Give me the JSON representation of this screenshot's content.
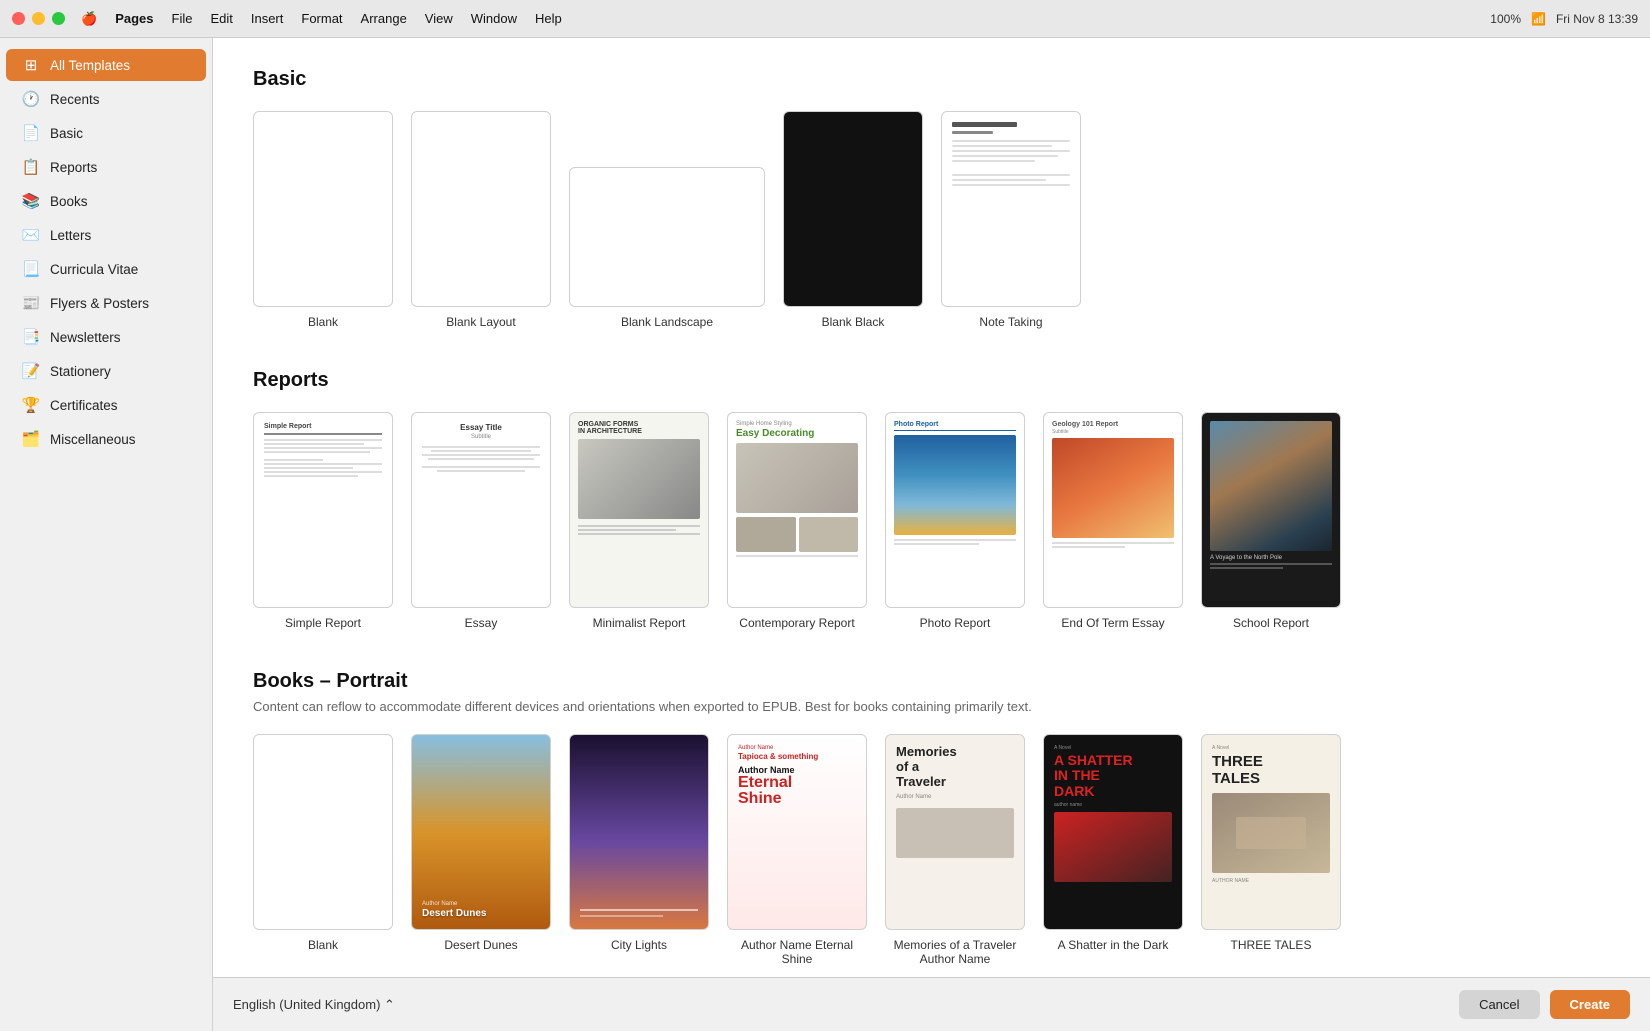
{
  "titlebar": {
    "app": "Pages",
    "menus": [
      "Apple",
      "Pages",
      "File",
      "Edit",
      "Insert",
      "Format",
      "Arrange",
      "View",
      "Window",
      "Help"
    ],
    "status": "100%",
    "time": "Fri Nov 8  13:39"
  },
  "sidebar": {
    "items": [
      {
        "id": "all-templates",
        "label": "All Templates",
        "icon": "⊞",
        "active": true
      },
      {
        "id": "recents",
        "label": "Recents",
        "icon": "🕐",
        "active": false
      },
      {
        "id": "basic",
        "label": "Basic",
        "icon": "📄",
        "active": false
      },
      {
        "id": "reports",
        "label": "Reports",
        "icon": "📋",
        "active": false
      },
      {
        "id": "books",
        "label": "Books",
        "icon": "📚",
        "active": false
      },
      {
        "id": "letters",
        "label": "Letters",
        "icon": "✉️",
        "active": false
      },
      {
        "id": "curricula-vitae",
        "label": "Curricula Vitae",
        "icon": "📃",
        "active": false
      },
      {
        "id": "flyers-posters",
        "label": "Flyers & Posters",
        "icon": "📰",
        "active": false
      },
      {
        "id": "newsletters",
        "label": "Newsletters",
        "icon": "📑",
        "active": false
      },
      {
        "id": "stationery",
        "label": "Stationery",
        "icon": "📝",
        "active": false
      },
      {
        "id": "certificates",
        "label": "Certificates",
        "icon": "🏆",
        "active": false
      },
      {
        "id": "miscellaneous",
        "label": "Miscellaneous",
        "icon": "🗂️",
        "active": false
      }
    ]
  },
  "basic": {
    "title": "Basic",
    "templates": [
      {
        "id": "blank",
        "label": "Blank"
      },
      {
        "id": "blank-layout",
        "label": "Blank Layout"
      },
      {
        "id": "blank-landscape",
        "label": "Blank Landscape"
      },
      {
        "id": "blank-black",
        "label": "Blank Black"
      },
      {
        "id": "note-taking",
        "label": "Note Taking"
      }
    ]
  },
  "reports": {
    "title": "Reports",
    "templates": [
      {
        "id": "simple-report",
        "label": "Simple Report"
      },
      {
        "id": "essay",
        "label": "Essay"
      },
      {
        "id": "minimalist-report",
        "label": "Minimalist Report"
      },
      {
        "id": "contemporary-report",
        "label": "Contemporary Report"
      },
      {
        "id": "photo-report",
        "label": "Photo Report"
      },
      {
        "id": "end-of-term-essay",
        "label": "End Of Term Essay"
      },
      {
        "id": "school-report",
        "label": "School Report"
      }
    ]
  },
  "books": {
    "title": "Books – Portrait",
    "subtitle": "Content can reflow to accommodate different devices and orientations when exported to EPUB. Best for books containing primarily text.",
    "templates": [
      {
        "id": "book-blank",
        "label": "Blank"
      },
      {
        "id": "desert-dunes",
        "label": "Desert Dunes"
      },
      {
        "id": "city-lights",
        "label": "City Lights"
      },
      {
        "id": "author-shine",
        "label": "Author Name Eternal Shine"
      },
      {
        "id": "memories-traveler",
        "label": "Memories of a Traveler Author Name"
      },
      {
        "id": "shatter-dark",
        "label": "A Shatter in the Dark"
      },
      {
        "id": "three-tales",
        "label": "THREE TALES"
      }
    ]
  },
  "bottom": {
    "language": "English (United Kingdom)",
    "cancel": "Cancel",
    "create": "Create"
  }
}
